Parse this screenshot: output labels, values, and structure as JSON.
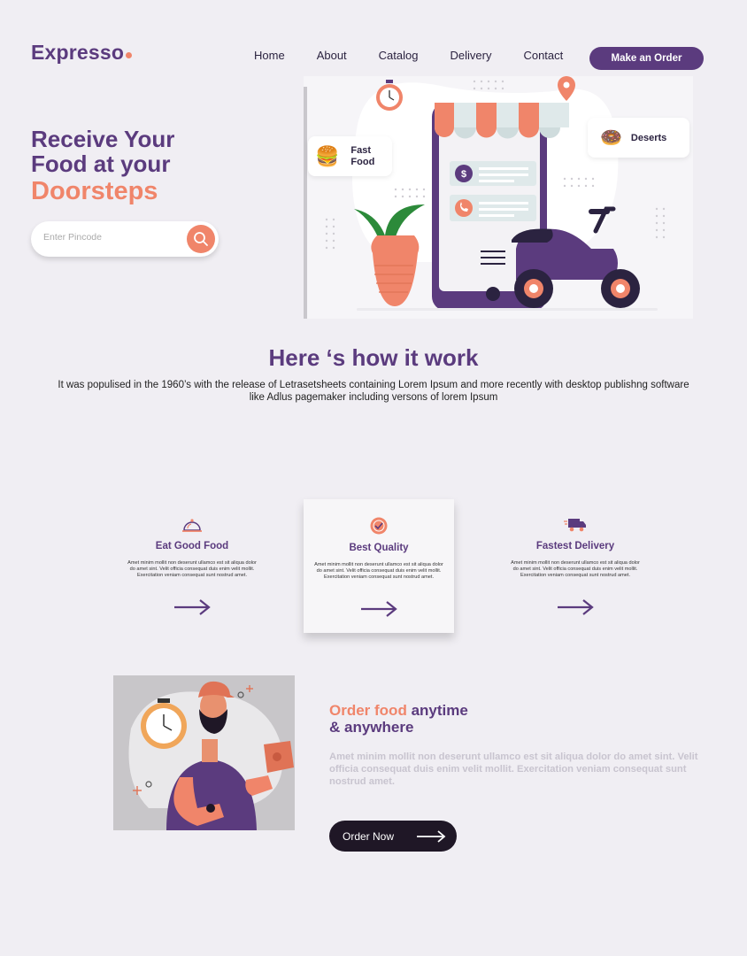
{
  "brand": {
    "name": "Expresso"
  },
  "nav": {
    "items": [
      "Home",
      "About",
      "Catalog",
      "Delivery",
      "Contact"
    ],
    "cta": "Make an Order"
  },
  "hero": {
    "title_line1": "Receive Your",
    "title_line2": "Food at your",
    "title_line3": "Doorsteps",
    "pincode_placeholder": "Enter Pincode",
    "card_fast_food": "Fast Food",
    "card_deserts": "Deserts"
  },
  "how": {
    "title": "Here ‘s how it work",
    "description": "It was populised in the 1960’s with the release of Letrasetsheets containing Lorem Ipsum and more recently with desktop publishng software like Adlus pagemaker including versons of lorem Ipsum"
  },
  "features": [
    {
      "title": "Eat Good Food",
      "text": "Amet minim mollit non deserunt ullamco est sit aliqua dolor do amet sint. Velit officia consequat duis enim velit mollit. Exercitation veniam consequat sunt nostrud amet."
    },
    {
      "title": "Best Quality",
      "text": "Amet minim mollit non deserunt ullamco est sit aliqua dolor do amet sint. Velit officia consequat duis enim velit mollit. Exercitation veniam consequat sunt nostrud amet."
    },
    {
      "title": "Fastest Delivery",
      "text": "Amet minim mollit non deserunt ullamco est sit aliqua dolor do amet sint. Velit officia consequat duis enim velit mollit. Exercitation veniam consequat sunt nostrud amet."
    }
  ],
  "order": {
    "title_accent": "Order food",
    "title_rest": "anytime",
    "title_line2": "& anywhere",
    "description": "Amet minim mollit non deserunt ullamco est sit aliqua dolor do amet sint. Velit officia consequat duis enim velit mollit. Exercitation veniam consequat sunt nostrud amet.",
    "button": "Order Now"
  },
  "colors": {
    "primary": "#5b3b7e",
    "accent": "#f0856a",
    "background": "#f0eef3",
    "dark": "#1f1726"
  }
}
